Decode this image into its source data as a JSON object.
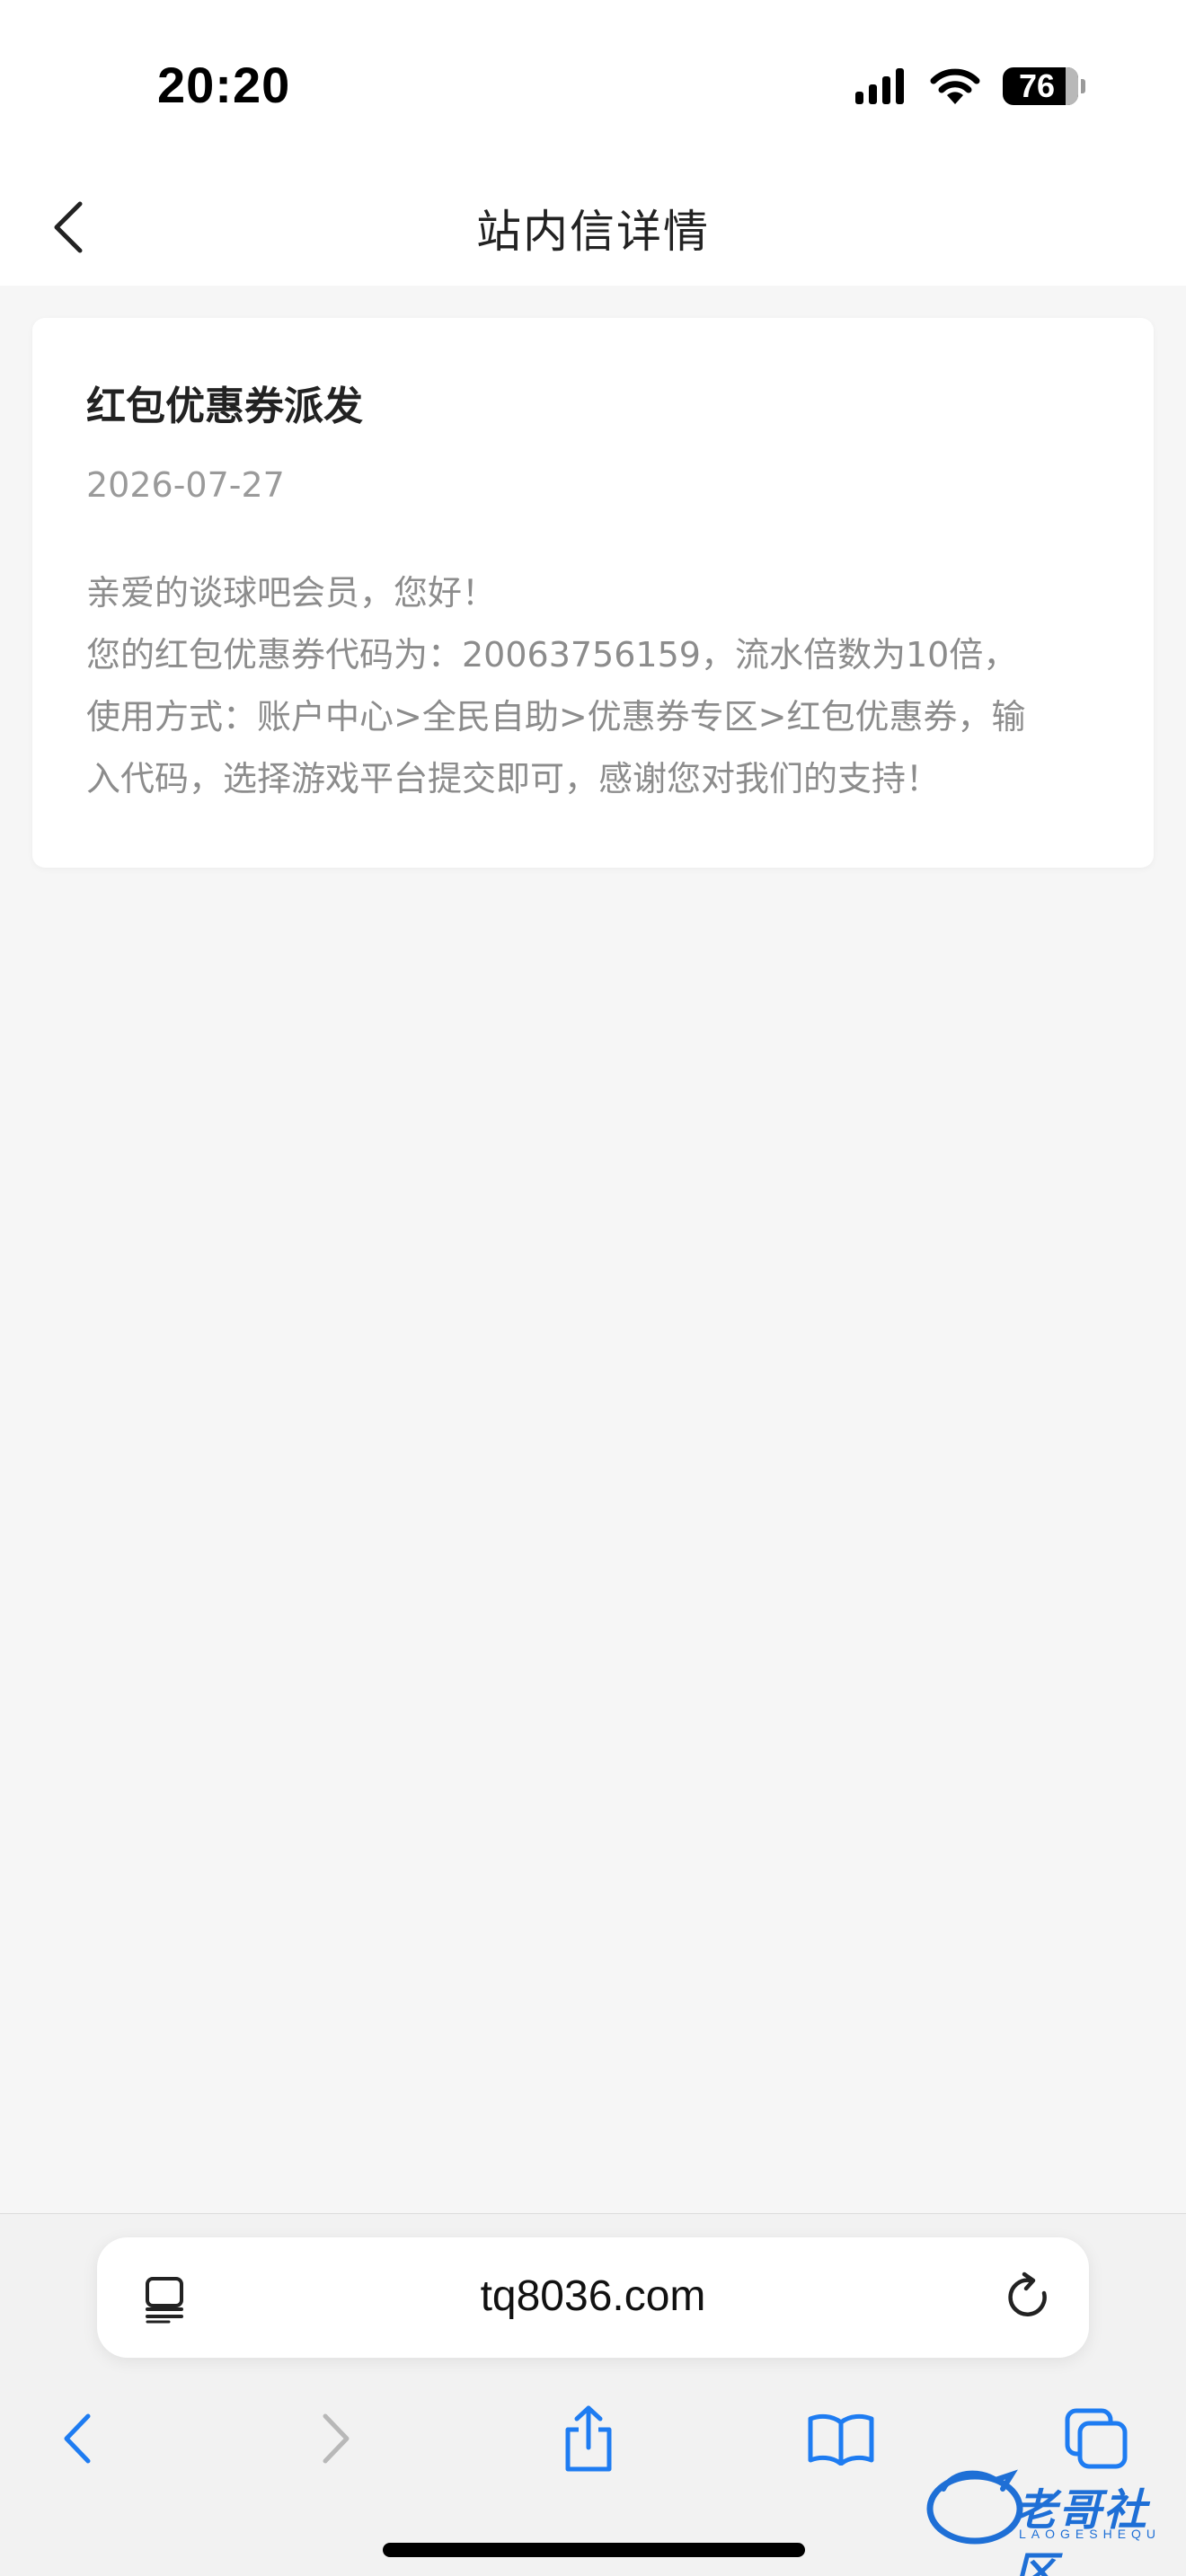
{
  "status_bar": {
    "time": "20:20",
    "battery": "76",
    "battery_level_pct": 76
  },
  "nav": {
    "title": "站内信详情"
  },
  "message": {
    "title": "红包优惠券派发",
    "date": "2026-07-27",
    "body_lines": [
      "亲爱的谈球吧会员，您好！",
      "您的红包优惠券代码为：20063756159，流水倍数为10倍，",
      "使用方式：账户中心>全民自助>优惠券专区>红包优惠券，输",
      "入代码，选择游戏平台提交即可，感谢您对我们的支持！"
    ]
  },
  "browser": {
    "url": "tq8036.com"
  },
  "watermark": {
    "text": "老哥社区",
    "sub": "LAOGESHEQU"
  },
  "colors": {
    "accent": "#1e7cf2",
    "disabled": "#b8b8b8",
    "background": "#f6f6f6"
  }
}
